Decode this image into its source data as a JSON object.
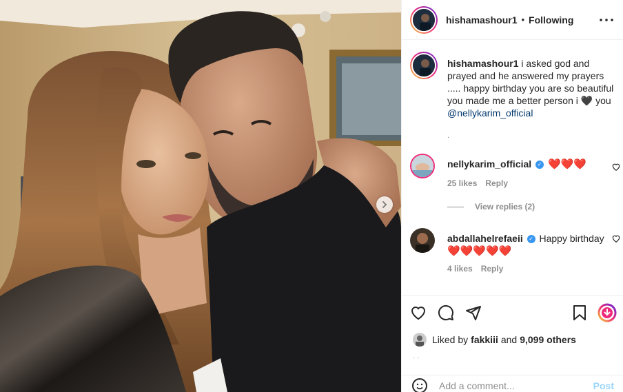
{
  "header": {
    "username": "hishamashour1",
    "separator": "•",
    "follow_label": "Following",
    "more_icon": "more-horizontal-icon"
  },
  "caption": {
    "username": "hishamashour1",
    "text_before": " i asked god and prayed and he answered my prayers ..... happy birthday you are so beautiful you made me a better person i ",
    "heart": "🖤",
    "text_after": " you",
    "mention": "@nellykarim_official",
    "tail": "."
  },
  "comments": [
    {
      "username": "nellykarim_official",
      "verified": true,
      "text": "",
      "hearts": "❤️❤️❤️",
      "likes": "25 likes",
      "reply": "Reply",
      "view_replies": "View replies (2)"
    },
    {
      "username": "abdallahelrefaeii",
      "verified": true,
      "text": "Happy birthday",
      "hearts": "❤️❤️❤️❤️❤️",
      "likes": "4 likes",
      "reply": "Reply"
    }
  ],
  "likes": {
    "prefix": "Liked by",
    "user": "fakkiii",
    "middle": "and",
    "others": "9,099 others"
  },
  "time_ago": "· ·",
  "add_comment": {
    "placeholder": "Add a comment...",
    "post_label": "Post"
  },
  "colors": {
    "link": "#00376b",
    "post": "#0095f6",
    "verified": "#3897f0",
    "heart": "#ed4956"
  }
}
